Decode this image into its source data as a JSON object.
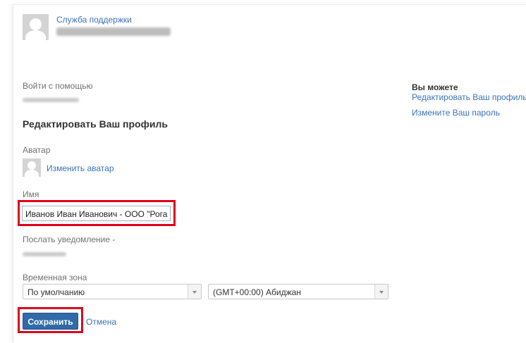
{
  "header": {
    "support_link": "Служба поддержки"
  },
  "login": {
    "label": "Войти с помощью"
  },
  "section_title": "Редактировать Ваш профиль",
  "avatar": {
    "label": "Аватар",
    "change_link": "Изменить аватар"
  },
  "name": {
    "label": "Имя",
    "value": "Иванов Иван Иванович - ООО \"Рога"
  },
  "notify": {
    "label": "Послать уведомление -"
  },
  "timezone": {
    "label": "Временная зона",
    "select1": "По умолчанию",
    "select2": "(GMT+00:00) Абиджан"
  },
  "actions": {
    "save": "Сохранить",
    "cancel": "Отмена"
  },
  "sidebar": {
    "title": "Вы можете",
    "edit_profile": "Редактировать Ваш профиль",
    "change_password": "Измените Ваш пароль"
  },
  "colors": {
    "link": "#3b73b9",
    "primary_button": "#2f6ba8",
    "highlight": "#e0001b"
  }
}
